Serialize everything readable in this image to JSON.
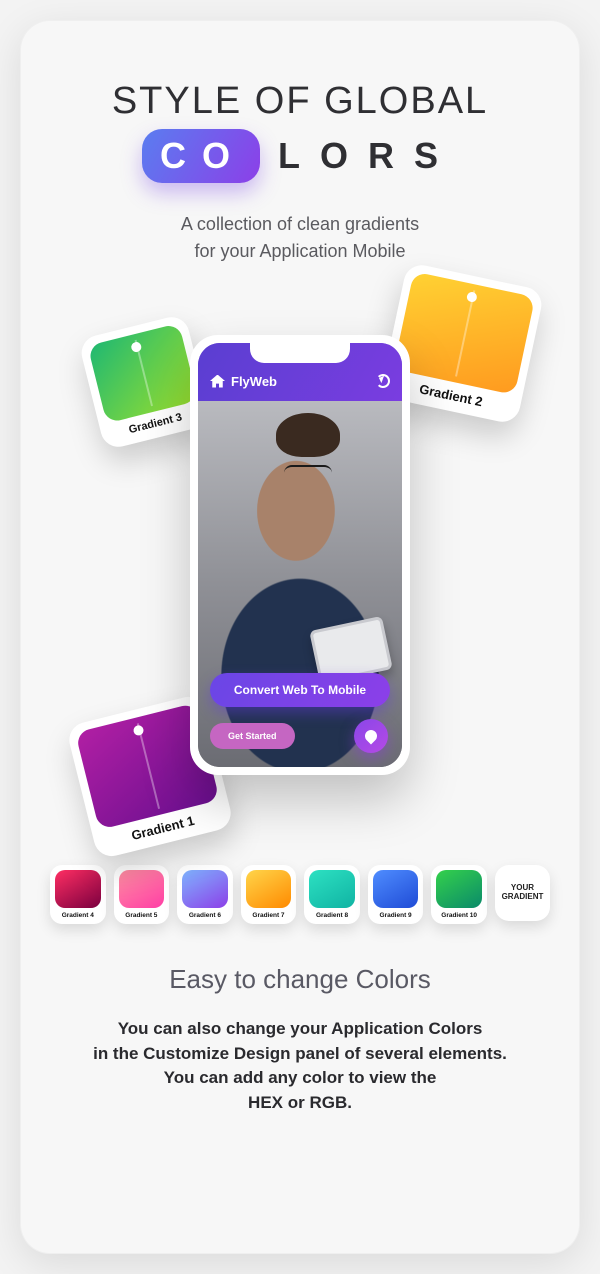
{
  "title": {
    "line1": "STYLE OF GLOBAL",
    "pill": "CO",
    "rest": "LORS"
  },
  "subtitle": {
    "l1": "A collection of clean gradients",
    "l2": "for your Application Mobile"
  },
  "hero": {
    "swatches": {
      "g1": {
        "label": "Gradient 1",
        "from": "#b11fa4",
        "to": "#6a0f8f"
      },
      "g2": {
        "label": "Gradient 2",
        "from": "#ffd233",
        "to": "#ff9a1f"
      },
      "g3": {
        "label": "Gradient 3",
        "from": "#1fb872",
        "to": "#9be02e"
      }
    },
    "app": {
      "name": "FlyWeb",
      "cta_main": "Convert Web To Mobile",
      "cta_secondary": "Get Started"
    }
  },
  "row": [
    {
      "label": "Gradient 4",
      "from": "#ff2e63",
      "to": "#7a003f"
    },
    {
      "label": "Gradient 5",
      "from": "#ff8fa3",
      "to": "#ff3ea5"
    },
    {
      "label": "Gradient 6",
      "from": "#7fb4ff",
      "to": "#8c3fe8"
    },
    {
      "label": "Gradient 7",
      "from": "#ffd54a",
      "to": "#ff8a00"
    },
    {
      "label": "Gradient 8",
      "from": "#2de1c2",
      "to": "#10b3a3"
    },
    {
      "label": "Gradient 9",
      "from": "#4f8dff",
      "to": "#1f4bd6"
    },
    {
      "label": "Gradient 10",
      "from": "#34d14b",
      "to": "#0a8a6a"
    }
  ],
  "your_gradient": "YOUR GRADIENT",
  "section2": {
    "title": "Easy to change Colors",
    "p1": "You can also change your Application Colors",
    "p2": "in the Customize Design panel of several elements.",
    "p3": "You can add any color to view the",
    "p4": "HEX or RGB."
  }
}
